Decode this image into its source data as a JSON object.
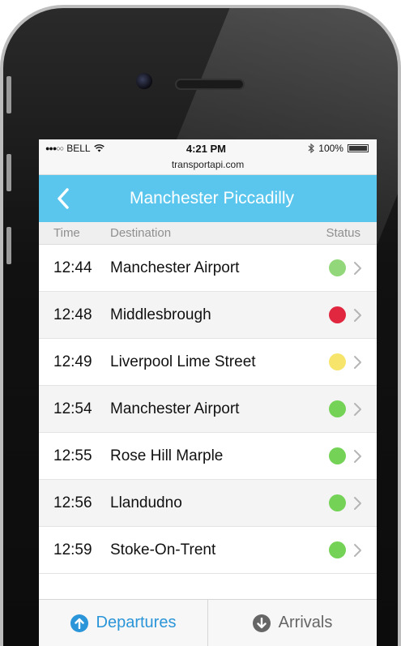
{
  "status_bar": {
    "carrier": "BELL",
    "time": "4:21 PM",
    "battery": "100%"
  },
  "url": "transportapi.com",
  "nav": {
    "title": "Manchester Piccadilly"
  },
  "columns": {
    "time": "Time",
    "destination": "Destination",
    "status": "Status"
  },
  "departures": [
    {
      "time": "12:44",
      "destination": "Manchester Airport",
      "status_color": "#92d87a"
    },
    {
      "time": "12:48",
      "destination": "Middlesbrough",
      "status_color": "#e0273f"
    },
    {
      "time": "12:49",
      "destination": "Liverpool Lime Street",
      "status_color": "#f7e56b"
    },
    {
      "time": "12:54",
      "destination": "Manchester Airport",
      "status_color": "#74d256"
    },
    {
      "time": "12:55",
      "destination": "Rose Hill Marple",
      "status_color": "#74d256"
    },
    {
      "time": "12:56",
      "destination": "Llandudno",
      "status_color": "#74d256"
    },
    {
      "time": "12:59",
      "destination": "Stoke-On-Trent",
      "status_color": "#74d256"
    }
  ],
  "tabs": [
    {
      "label": "Departures",
      "icon": "arrow-up-icon",
      "color": "#2a95d8",
      "active": true
    },
    {
      "label": "Arrivals",
      "icon": "arrow-down-icon",
      "color": "#666666",
      "active": false
    }
  ],
  "colors": {
    "accent": "#5ac6ee"
  }
}
